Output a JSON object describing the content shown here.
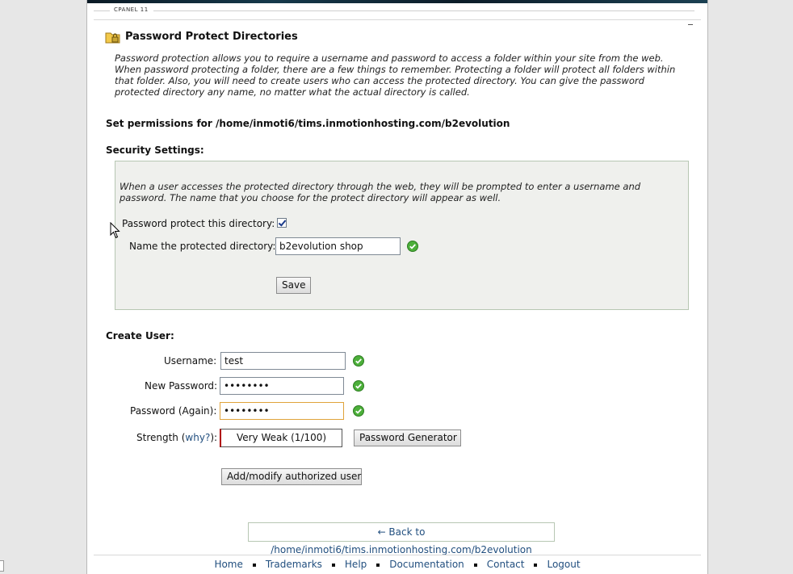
{
  "branding": {
    "product": "CPANEL 11"
  },
  "page": {
    "title": "Password Protect Directories",
    "intro": "Password protection allows you to require a username and password to access a folder within your site from the web. When password protecting a folder, there are a few things to remember. Protecting a folder will protect all folders within that folder. Also, you will need to create users who can access the protected directory. You can give the password protected directory any name, no matter what the actual directory is called.",
    "permissions_label": "Set permissions for /home/inmoti6/tims.inmotionhosting.com/b2evolution"
  },
  "security": {
    "heading": "Security Settings:",
    "message": "When a user accesses the protected directory through the web, they will be prompted to enter a username and password. The name that you choose for the protect directory will appear as well.",
    "protect_label": "Password protect this directory:",
    "protect_checked": true,
    "name_label": "Name the protected directory:",
    "name_value": "b2evolution shop",
    "save_label": "Save"
  },
  "create_user": {
    "heading": "Create User:",
    "username_label": "Username:",
    "username_value": "test",
    "password_label": "New Password:",
    "password_value": "••••••••",
    "password_again_label": "Password (Again):",
    "password_again_value": "••••••••",
    "strength_label": "Strength",
    "why_label": "why?",
    "strength_value": "Very Weak (1/100)",
    "generator_label": "Password Generator",
    "add_label": "Add/modify authorized user"
  },
  "back_link": "← Back to /home/inmoti6/tims.inmotionhosting.com/b2evolution",
  "footer": {
    "home": "Home",
    "trademarks": "Trademarks",
    "help": "Help",
    "documentation": "Documentation",
    "contact": "Contact",
    "logout": "Logout"
  },
  "colors": {
    "link": "#224f7f",
    "box_bg": "#eff0ed",
    "box_border": "#b7c7b3",
    "ok_green": "#4caf3a"
  }
}
